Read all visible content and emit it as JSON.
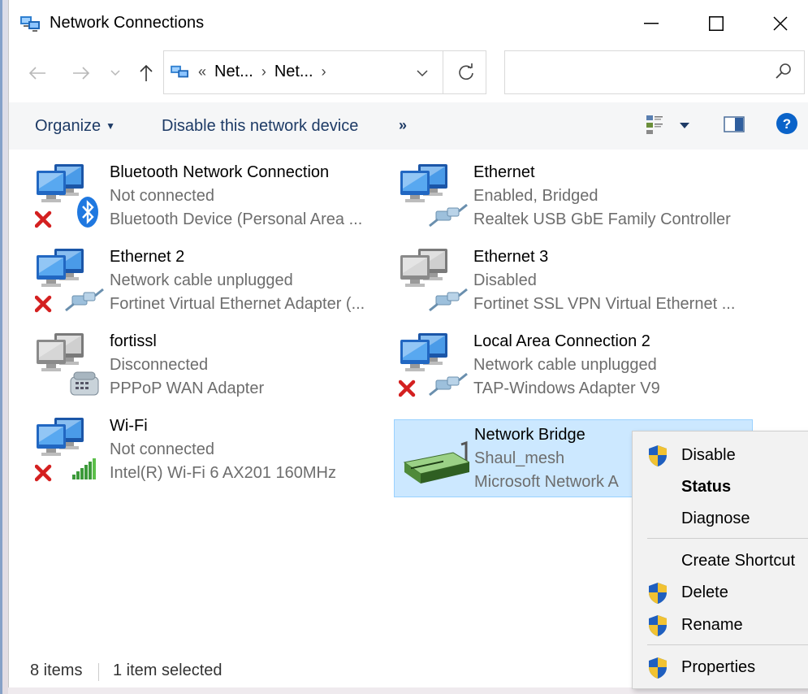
{
  "window": {
    "title": "Network Connections",
    "icons": {
      "app": "network-connections-icon",
      "minimize": "minimize-icon",
      "maximize": "maximize-icon",
      "close": "close-icon"
    }
  },
  "navigation": {
    "back_icon": "arrow-left-icon",
    "forward_icon": "arrow-right-icon",
    "recent_icon": "chevron-down-icon",
    "up_icon": "arrow-up-icon",
    "breadcrumb": {
      "overflow": "«",
      "items": [
        "Net...",
        "Net..."
      ],
      "separator": "›"
    },
    "refresh_icon": "refresh-icon",
    "search": {
      "placeholder": "",
      "value": "",
      "icon": "search-icon"
    }
  },
  "toolbar": {
    "organize": "Organize",
    "disable_device": "Disable this network device",
    "more": "»",
    "icons": [
      "change-view-icon",
      "preview-pane-icon",
      "help-icon"
    ]
  },
  "connections": [
    {
      "name": "Bluetooth Network Connection",
      "status": "Not connected",
      "device": "Bluetooth Device (Personal Area ...",
      "icon": "bluetooth-connection-icon",
      "error": true
    },
    {
      "name": "Ethernet",
      "status": "Enabled, Bridged",
      "device": "Realtek USB GbE Family Controller",
      "icon": "ethernet-connection-icon",
      "error": false
    },
    {
      "name": "Ethernet 2",
      "status": "Network cable unplugged",
      "device": "Fortinet Virtual Ethernet Adapter (...",
      "icon": "ethernet-connection-icon",
      "error": true
    },
    {
      "name": "Ethernet 3",
      "status": "Disabled",
      "device": "Fortinet SSL VPN Virtual Ethernet ...",
      "icon": "ethernet-disabled-icon",
      "error": false
    },
    {
      "name": "fortissl",
      "status": "Disconnected",
      "device": "PPPoP WAN Adapter",
      "icon": "dialup-connection-icon",
      "error": false
    },
    {
      "name": "Local Area Connection 2",
      "status": "Network cable unplugged",
      "device": "TAP-Windows Adapter V9",
      "icon": "ethernet-connection-icon",
      "error": true
    },
    {
      "name": "Wi-Fi",
      "status": "Not connected",
      "device": "Intel(R) Wi-Fi 6 AX201 160MHz",
      "icon": "wifi-connection-icon",
      "error": true
    },
    {
      "name": "Network Bridge",
      "status": "Shaul_mesh",
      "device": "Microsoft Network A",
      "icon": "network-bridge-icon",
      "error": false,
      "selected": true
    }
  ],
  "context_menu": {
    "items": [
      {
        "label": "Disable",
        "shield": true,
        "bold": false
      },
      {
        "label": "Status",
        "shield": false,
        "bold": true
      },
      {
        "label": "Diagnose",
        "shield": false,
        "bold": false
      },
      {
        "label": "Create Shortcut",
        "shield": false,
        "bold": false
      },
      {
        "label": "Delete",
        "shield": true,
        "bold": false
      },
      {
        "label": "Rename",
        "shield": true,
        "bold": false
      },
      {
        "label": "Properties",
        "shield": true,
        "bold": false
      }
    ]
  },
  "statusbar": {
    "count": "8 items",
    "selection": "1 item selected"
  },
  "colors": {
    "accent": "#0066cc",
    "command_text": "#1e3b66",
    "selection_bg": "#cce8ff",
    "selection_border": "#99d1ff",
    "error_red": "#d42020"
  }
}
